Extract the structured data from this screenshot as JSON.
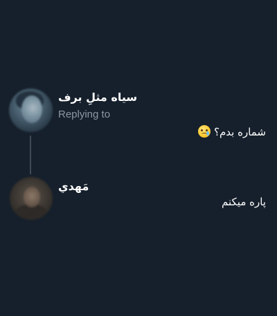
{
  "thread": {
    "tweets": [
      {
        "author_name": "سیاه مثلِ برف",
        "replying_label": "Replying to",
        "text": "شماره بدم؟",
        "emoji": "smiling-face-with-tear-emoji"
      },
      {
        "author_name": "مَهدي",
        "text": "پاره میکنم"
      }
    ]
  },
  "colors": {
    "background": "#16202c",
    "text_primary": "#ffffff",
    "text_secondary": "#8b98a5",
    "thread_line": "#3d4a57"
  }
}
